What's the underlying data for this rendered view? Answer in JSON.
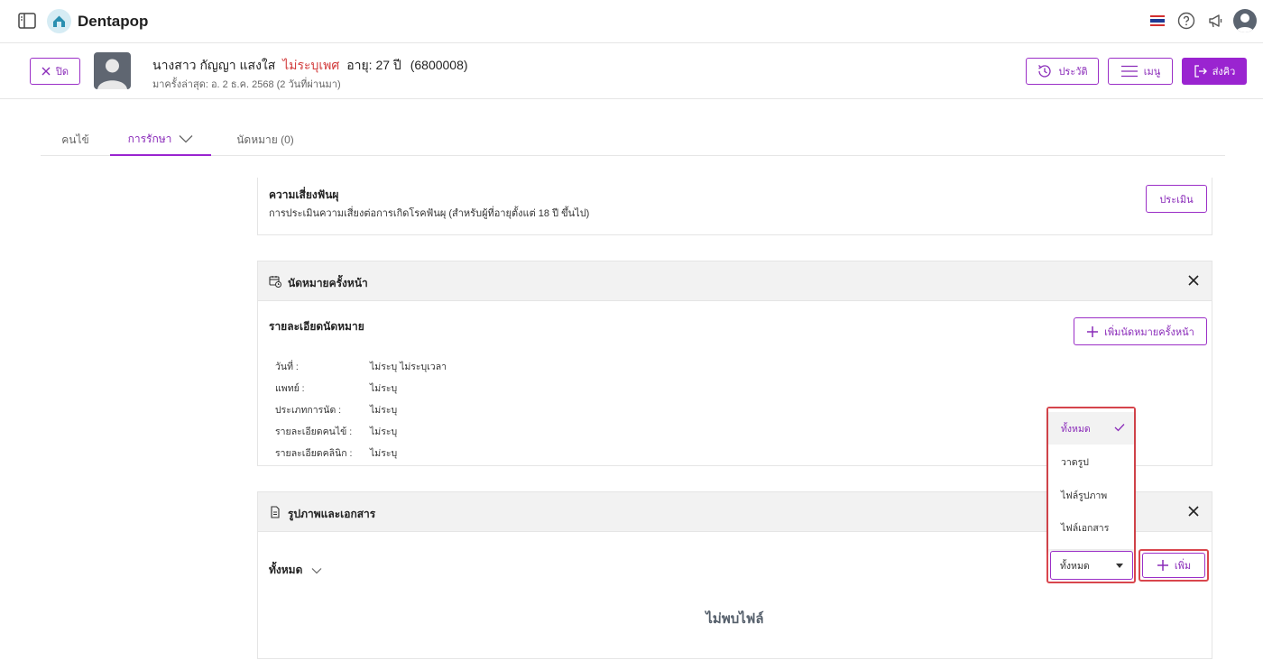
{
  "app": {
    "name": "Dentapop"
  },
  "topbar": {
    "icons": [
      "sidebar-toggle-icon",
      "thai-flag-icon",
      "help-icon",
      "announce-icon",
      "user-avatar"
    ]
  },
  "patient": {
    "close_label": "ปิด",
    "title": "นางสาว",
    "name": "กัญญา แสงใส",
    "gender": "ไม่ระบุเพศ",
    "age": "อายุ: 27 ปี",
    "hn": "(6800008)",
    "last_visit": "มาครั้งล่าสุด: อ. 2 ธ.ค. 2568 (2 วันที่ผ่านมา)",
    "history_label": "ประวัติ",
    "menu_label": "เมนู",
    "send_label": "ส่งคิว"
  },
  "tabs": [
    {
      "label": "คนไข้"
    },
    {
      "label": "การรักษา"
    },
    {
      "label": "นัดหมาย (0)"
    }
  ],
  "risk": {
    "title": "ความเสี่ยงฟันผุ",
    "description": "การประเมินความเสี่ยงต่อการเกิดโรคฟันผุ (สำหรับผู้ที่อายุตั้งแต่ 18 ปี ขึ้นไป)",
    "assess_label": "ประเมิน"
  },
  "appointment": {
    "header": "นัดหมายครั้งหน้า",
    "detail_title": "รายละเอียดนัดหมาย",
    "add_label": "เพิ่มนัดหมายครั้งหน้า",
    "rows": [
      {
        "label": "วันที่ :",
        "value": "ไม่ระบุ  ไม่ระบุเวลา"
      },
      {
        "label": "แพทย์ :",
        "value": "ไม่ระบุ"
      },
      {
        "label": "ประเภทการนัด :",
        "value": "ไม่ระบุ"
      },
      {
        "label": "รายละเอียดคนไข้ :",
        "value": "ไม่ระบุ"
      },
      {
        "label": "รายละเอียดคลินิก :",
        "value": "ไม่ระบุ"
      }
    ]
  },
  "documents": {
    "header": "รูปภาพและเอกสาร",
    "filter_label": "ทั้งหมด",
    "empty_text": "ไม่พบไฟล์",
    "add_label": "เพิ่ม",
    "dropdown": {
      "selected": "ทั้งหมด",
      "options": [
        "ทั้งหมด",
        "วาดรูป",
        "ไฟล์รูปภาพ",
        "ไฟล์เอกสาร"
      ]
    }
  },
  "colors": {
    "accent": "#9a24d0",
    "danger": "#d23b3b",
    "highlight_border": "#d9464d"
  }
}
